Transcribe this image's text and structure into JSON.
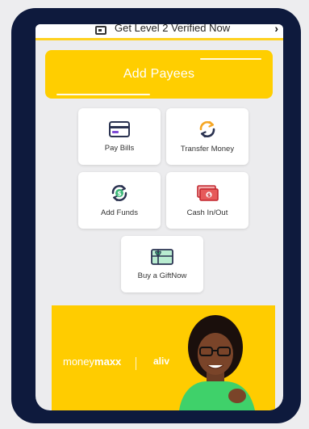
{
  "verify_bar": {
    "text": "Get Level 2 Verified Now",
    "chevron": "›"
  },
  "add_payees": {
    "label": "Add Payees"
  },
  "tiles": [
    {
      "label": "Pay Bills",
      "icon": "card-icon"
    },
    {
      "label": "Transfer Money",
      "icon": "refresh-icon"
    },
    {
      "label": "Add Funds",
      "icon": "dollar-refresh-icon"
    },
    {
      "label": "Cash In/Out",
      "icon": "cash-icon"
    },
    {
      "label": "Buy a GiftNow",
      "icon": "gift-card-icon"
    }
  ],
  "banner": {
    "brand_money": "money",
    "brand_maxx": "maxx",
    "brand_partner": "aliv"
  },
  "colors": {
    "accent": "#ffce00",
    "frame": "#0e1a3d",
    "background": "#ececee"
  }
}
